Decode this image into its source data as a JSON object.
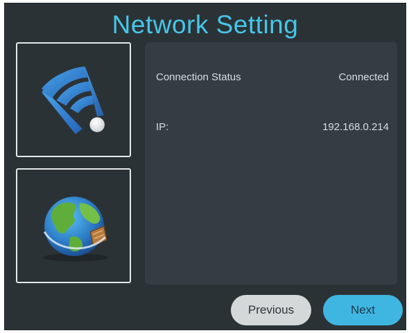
{
  "page": {
    "title": "Network Setting"
  },
  "tiles": {
    "wifi_icon": "wifi-icon",
    "globe_icon": "globe-icon"
  },
  "info": {
    "status_label": "Connection Status",
    "status_value": "Connected",
    "ip_label": "IP:",
    "ip_value": "192.168.0.214"
  },
  "buttons": {
    "previous_label": "Previous",
    "next_label": "Next"
  },
  "colors": {
    "title": "#46c6e8",
    "background": "#2b3236",
    "panel": "#353d42",
    "next_button": "#3fb6e2",
    "previous_button": "#d5d8d9",
    "wifi_blue": "#2f7fd0"
  }
}
